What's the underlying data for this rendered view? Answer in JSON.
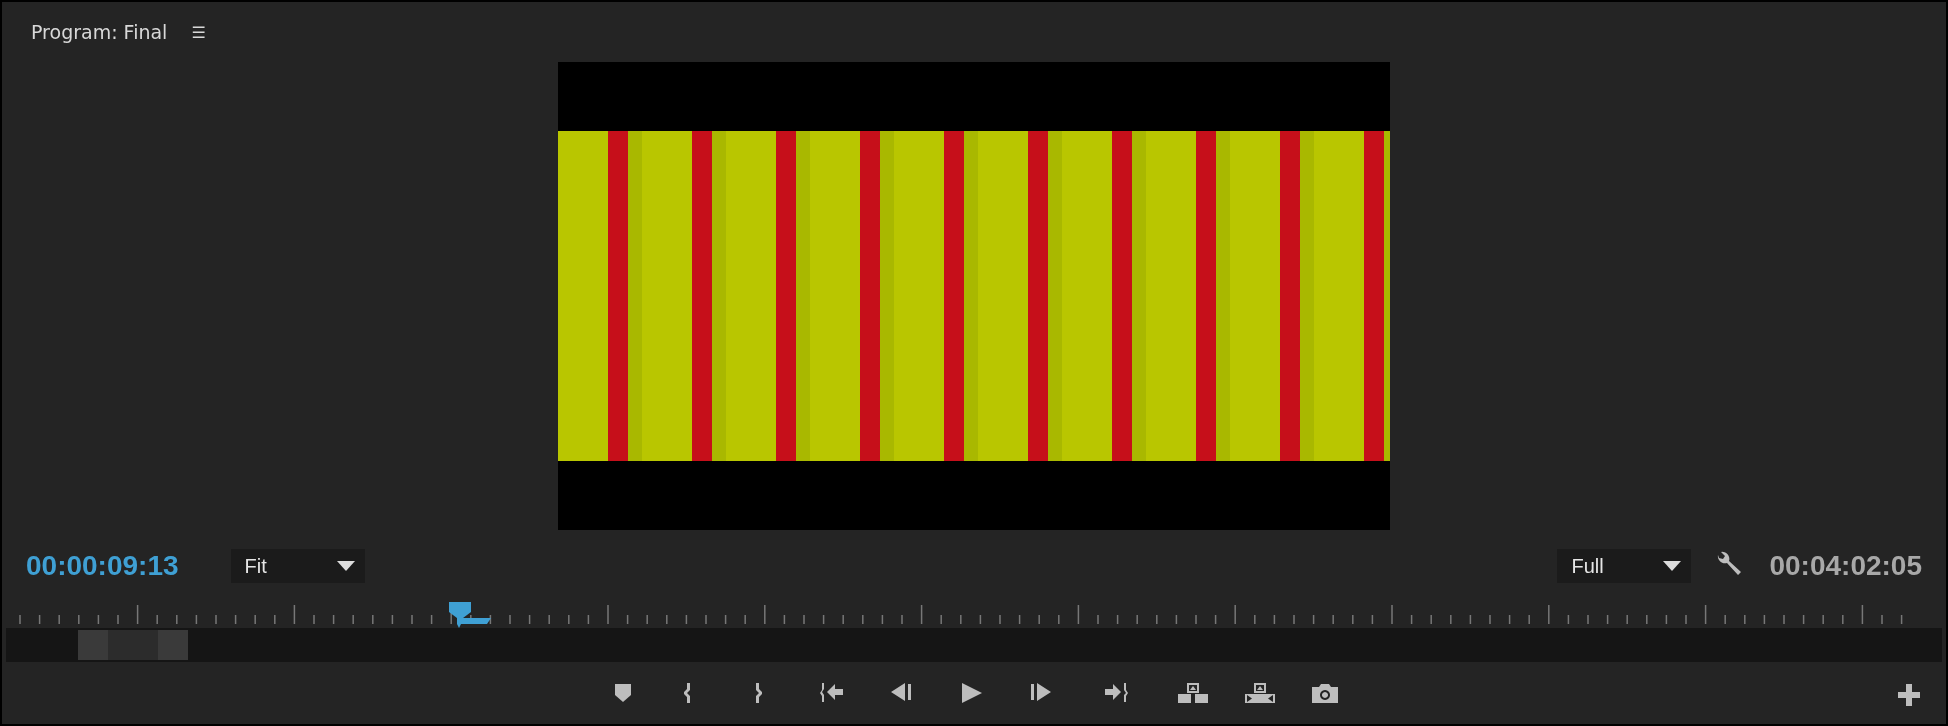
{
  "panel": {
    "title": "Program: Final",
    "menu_glyph": "☰"
  },
  "current_timecode": "00:00:09:13",
  "zoom_dropdown": {
    "value": "Fit"
  },
  "resolution_dropdown": {
    "value": "Full"
  },
  "duration_timecode": "00:04:02:05",
  "playhead": {
    "level": 0.235
  },
  "transport": [
    {
      "kind": "marker"
    },
    {
      "kind": "mark-in"
    },
    {
      "kind": "mark-out"
    },
    {
      "kind": "go-to-in"
    },
    {
      "kind": "step-back"
    },
    {
      "kind": "play"
    },
    {
      "kind": "step-forward"
    },
    {
      "kind": "go-to-out"
    },
    {
      "kind": "lift"
    },
    {
      "kind": "extract"
    },
    {
      "kind": "export-frame"
    }
  ]
}
